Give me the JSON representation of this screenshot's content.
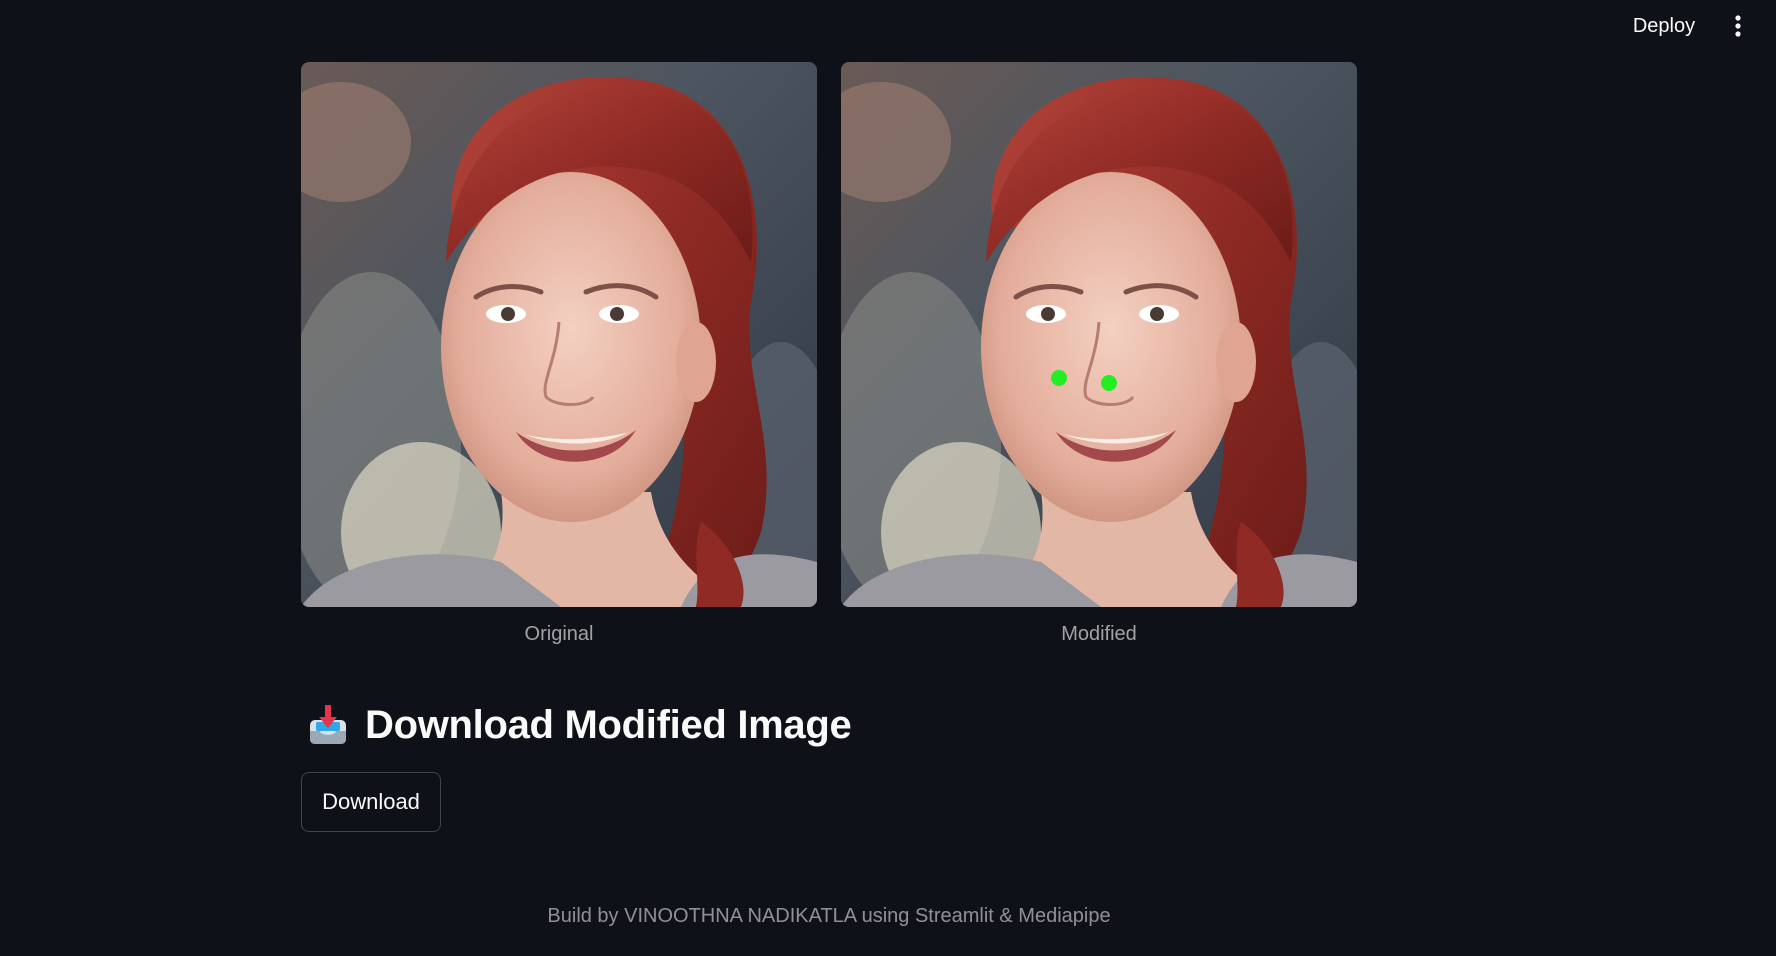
{
  "header": {
    "deploy_label": "Deploy",
    "menu_icon": "kebab-menu-icon"
  },
  "images": {
    "original_caption": "Original",
    "modified_caption": "Modified",
    "marker_color": "#22ee22"
  },
  "heading": {
    "emoji_icon": "inbox-tray-icon",
    "text": "Download Modified Image"
  },
  "download": {
    "label": "Download"
  },
  "footer": {
    "text": "Build by VINOOTHNA NADIKATLA using Streamlit & Mediapipe"
  },
  "colors": {
    "background": "#0e1117",
    "text": "#fafafa"
  }
}
